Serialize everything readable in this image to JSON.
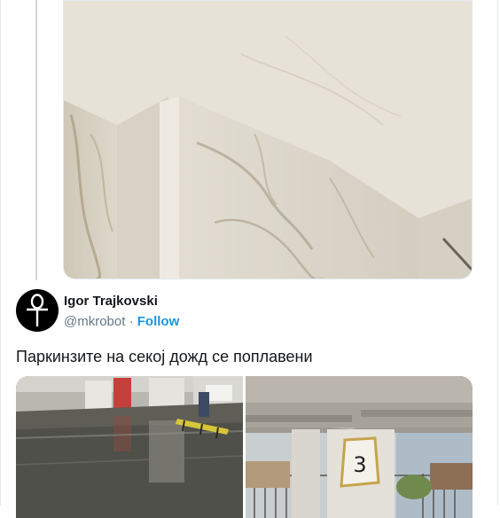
{
  "tweet": {
    "author_name": "Igor Trajkovski",
    "handle": "@mkrobot",
    "separator": "·",
    "follow_label": "Follow",
    "text": "Паркинзите на секој дожд се поплавени"
  },
  "photos": {
    "right_marker": "3"
  },
  "colors": {
    "link": "#1b95e0",
    "text": "#14171a",
    "secondary": "#657786",
    "border": "#e1e8ed"
  },
  "icons": {
    "avatar": "ankh-icon"
  }
}
